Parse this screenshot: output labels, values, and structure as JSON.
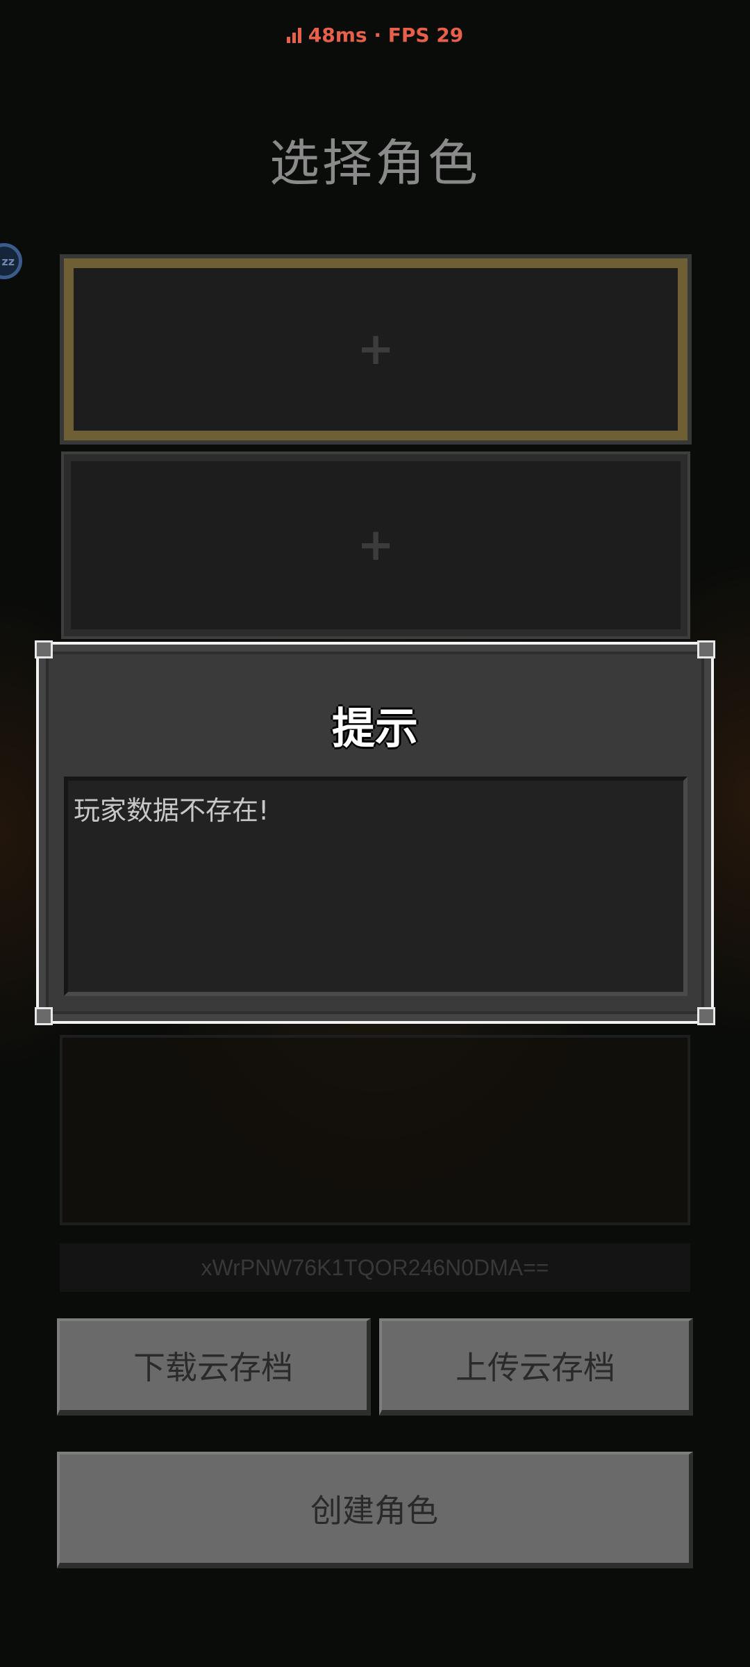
{
  "status": {
    "signal_icon": "signal-bars-icon",
    "text": "48ms · FPS 29",
    "color": "#e8604a"
  },
  "title": "选择角色",
  "float_button": {
    "label": "zz"
  },
  "slots": [
    {
      "icon": "+"
    },
    {
      "icon": "+"
    }
  ],
  "player_id": "xWrPNW76K1TQOR246N0DMA==",
  "buttons": {
    "download": "下载云存档",
    "upload": "上传云存档",
    "create": "创建角色"
  },
  "dialog": {
    "title": "提示",
    "message": "玩家数据不存在!"
  }
}
